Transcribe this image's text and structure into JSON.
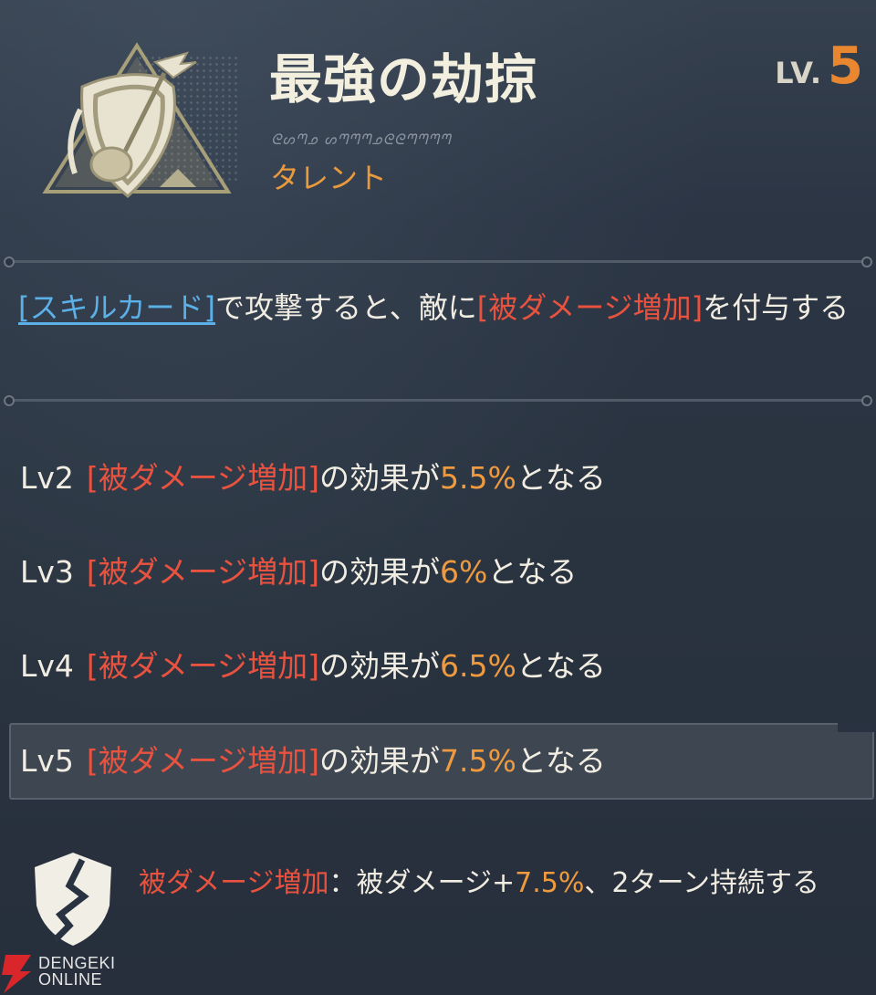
{
  "header": {
    "title": "最強の劫掠",
    "script_text": "ᘓᔕᘉᓄ ᔕᘉᘉᘉᓄᘓᘓᘉᘉᘉᘉ",
    "category": "タレント",
    "level_label": "LV.",
    "level_value": "5",
    "emblem_icon": "shield-sword-emblem-icon"
  },
  "description": {
    "part1": "[スキルカード]",
    "part2": "で攻撃すると、敵に",
    "part3": "[被ダメージ増加]",
    "part4": "を付与する"
  },
  "levels": [
    {
      "label": "Lv2",
      "effect": "[被ダメージ増加]",
      "mid": "の効果が",
      "value": "5.5%",
      "end": "となる"
    },
    {
      "label": "Lv3",
      "effect": "[被ダメージ増加]",
      "mid": "の効果が",
      "value": "6%",
      "end": "となる"
    },
    {
      "label": "Lv4",
      "effect": "[被ダメージ増加]",
      "mid": "の効果が",
      "value": "6.5%",
      "end": "となる"
    },
    {
      "label": "Lv5",
      "effect": "[被ダメージ増加]",
      "mid": "の効果が",
      "value": "7.5%",
      "end": "となる"
    }
  ],
  "current_level": "Lv5",
  "note": {
    "icon": "cracked-shield-icon",
    "term": "被ダメージ増加",
    "sep": "：被ダメージ+",
    "value": "7.5%",
    "rest": "、2ターン持続する"
  },
  "watermark": {
    "line1": "DENGEKI",
    "line2": "ONLINE",
    "icon": "lightning-logo-icon"
  },
  "colors": {
    "background": "#283241",
    "accent_orange": "#ef9a3e",
    "keyword_red": "#e9523f",
    "link_blue": "#5cb0e8"
  }
}
